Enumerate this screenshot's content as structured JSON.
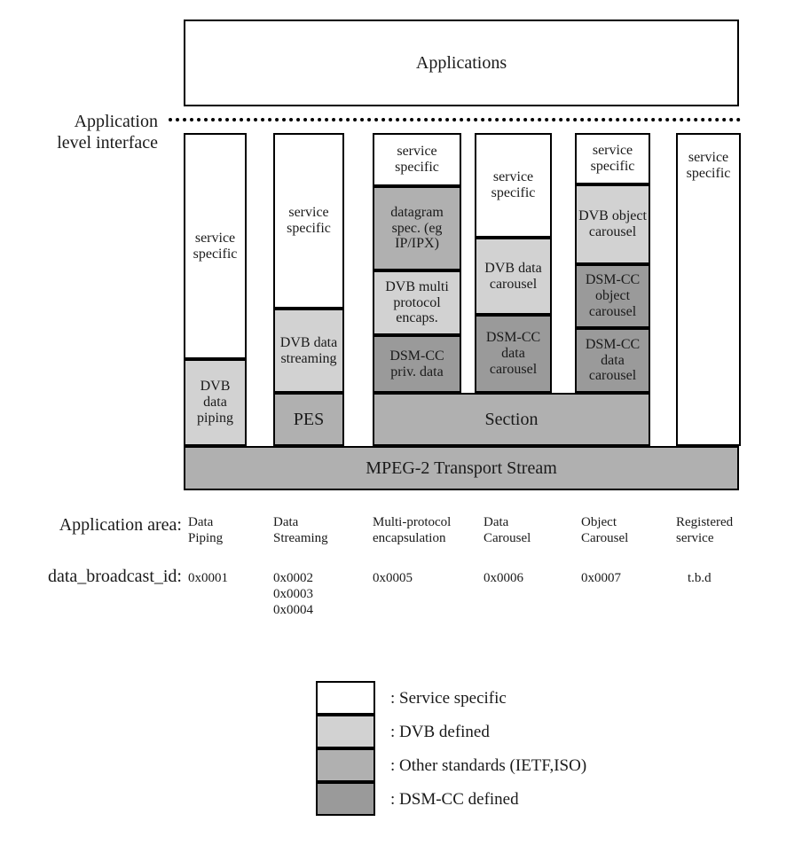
{
  "diagram": {
    "title_box": {
      "label": "Applications"
    },
    "interface_line_label": "Application\nlevel interface",
    "transport_bar": {
      "label": "MPEG-2 Transport Stream"
    },
    "section_bar": {
      "label": "Section"
    },
    "columns": [
      {
        "id": "data-piping",
        "layers": [
          {
            "label": "service\nspecific",
            "fill": "white"
          },
          {
            "label": "DVB\ndata\npiping",
            "fill": "dvb"
          }
        ]
      },
      {
        "id": "data-streaming",
        "layers": [
          {
            "label": "service\nspecific",
            "fill": "white"
          },
          {
            "label": "DVB\ndata\nstreaming",
            "fill": "dvb"
          },
          {
            "label": "PES",
            "fill": "other"
          }
        ]
      },
      {
        "id": "multi-protocol-encapsulation",
        "layers": [
          {
            "label": "service\nspecific",
            "fill": "white"
          },
          {
            "label": "datagram\nspec. (eg\nIP/IPX)",
            "fill": "other"
          },
          {
            "label": "DVB  multi\nprotocol\nencaps.",
            "fill": "dvb"
          },
          {
            "label": "DSM-CC\npriv. data",
            "fill": "dsmcc"
          }
        ]
      },
      {
        "id": "data-carousel",
        "layers": [
          {
            "label": "service\nspecific",
            "fill": "white"
          },
          {
            "label": "DVB\ndata\ncarousel",
            "fill": "dvb"
          },
          {
            "label": "DSM-CC\ndata\ncarousel",
            "fill": "dsmcc"
          }
        ]
      },
      {
        "id": "object-carousel",
        "layers": [
          {
            "label": "service\nspecific",
            "fill": "white"
          },
          {
            "label": "DVB\nobject\ncarousel",
            "fill": "dvb"
          },
          {
            "label": "DSM-CC\nobject\ncarousel",
            "fill": "dsmcc"
          },
          {
            "label": "DSM-CC\ndata\ncarousel",
            "fill": "dsmcc"
          }
        ]
      },
      {
        "id": "registered-service",
        "layers": [
          {
            "label": "service\nspecific",
            "fill": "white"
          }
        ]
      }
    ]
  },
  "table": {
    "row_labels": {
      "application_area": "Application area:",
      "data_broadcast_id": "data_broadcast_id:"
    },
    "application_area": [
      "Data\nPiping",
      "Data\nStreaming",
      "Multi-protocol\nencapsulation",
      "Data\nCarousel",
      "Object\nCarousel",
      "Registered\nservice"
    ],
    "data_broadcast_id": [
      "0x0001",
      "0x0002\n0x0003\n0x0004",
      "0x0005",
      "0x0006",
      "0x0007",
      "t.b.d"
    ]
  },
  "legend": {
    "items": [
      {
        "fill": "white",
        "label": ": Service specific"
      },
      {
        "fill": "dvb",
        "label": ": DVB defined"
      },
      {
        "fill": "other",
        "label": ": Other standards (IETF,ISO)"
      },
      {
        "fill": "dsmcc",
        "label": ": DSM-CC defined"
      }
    ]
  },
  "colors": {
    "service_specific": "#ffffff",
    "dvb_defined": "#d2d2d2",
    "other_standards": "#b0b0b0",
    "dsmcc_defined": "#9a9a9a",
    "outline": "#000000"
  }
}
